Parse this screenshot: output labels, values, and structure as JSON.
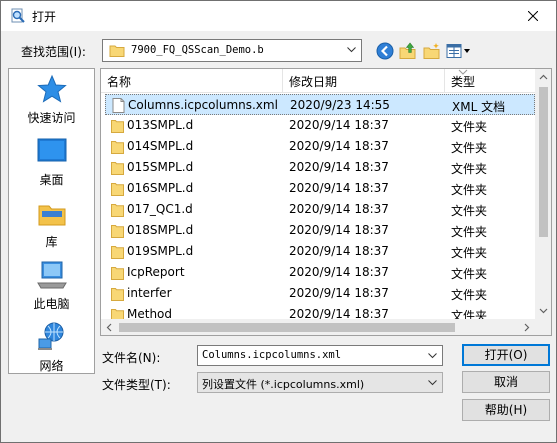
{
  "window": {
    "title": "打开",
    "colors": {
      "accent": "#0078d7",
      "selection": "#cce8ff",
      "folder": "#f8d775"
    }
  },
  "lookin": {
    "label": "查找范围(I):",
    "value": "7900_FQ_QSScan_Demo.b",
    "icon": "folder-icon"
  },
  "toolbar": {
    "back_icon": "back-arrow-icon",
    "up_icon": "up-folder-icon",
    "new_folder_icon": "new-folder-icon",
    "views_icon": "views-menu-icon"
  },
  "places": [
    {
      "label": "快速访问",
      "icon": "star-icon"
    },
    {
      "label": "桌面",
      "icon": "desktop-icon"
    },
    {
      "label": "库",
      "icon": "library-icon"
    },
    {
      "label": "此电脑",
      "icon": "computer-icon"
    },
    {
      "label": "网络",
      "icon": "network-icon"
    }
  ],
  "columns": {
    "name": "名称",
    "date": "修改日期",
    "type": "类型"
  },
  "files": [
    {
      "name": "Columns.icpcolumns.xml",
      "date": "2020/9/23 14:55",
      "type": "XML 文档",
      "kind": "file",
      "selected": true
    },
    {
      "name": "013SMPL.d",
      "date": "2020/9/14 18:37",
      "type": "文件夹",
      "kind": "folder"
    },
    {
      "name": "014SMPL.d",
      "date": "2020/9/14 18:37",
      "type": "文件夹",
      "kind": "folder"
    },
    {
      "name": "015SMPL.d",
      "date": "2020/9/14 18:37",
      "type": "文件夹",
      "kind": "folder"
    },
    {
      "name": "016SMPL.d",
      "date": "2020/9/14 18:37",
      "type": "文件夹",
      "kind": "folder"
    },
    {
      "name": "017_QC1.d",
      "date": "2020/9/14 18:37",
      "type": "文件夹",
      "kind": "folder"
    },
    {
      "name": "018SMPL.d",
      "date": "2020/9/14 18:37",
      "type": "文件夹",
      "kind": "folder"
    },
    {
      "name": "019SMPL.d",
      "date": "2020/9/14 18:37",
      "type": "文件夹",
      "kind": "folder"
    },
    {
      "name": "IcpReport",
      "date": "2020/9/14 18:37",
      "type": "文件夹",
      "kind": "folder"
    },
    {
      "name": "interfer",
      "date": "2020/9/14 18:37",
      "type": "文件夹",
      "kind": "folder"
    },
    {
      "name": "Method",
      "date": "2020/9/14 18:37",
      "type": "文件夹",
      "kind": "folder"
    }
  ],
  "filename": {
    "label": "文件名(N):",
    "value": "Columns.icpcolumns.xml"
  },
  "filetype": {
    "label": "文件类型(T):",
    "value": "列设置文件 (*.icpcolumns.xml)"
  },
  "buttons": {
    "open": "打开(O)",
    "cancel": "取消",
    "help": "帮助(H)"
  }
}
